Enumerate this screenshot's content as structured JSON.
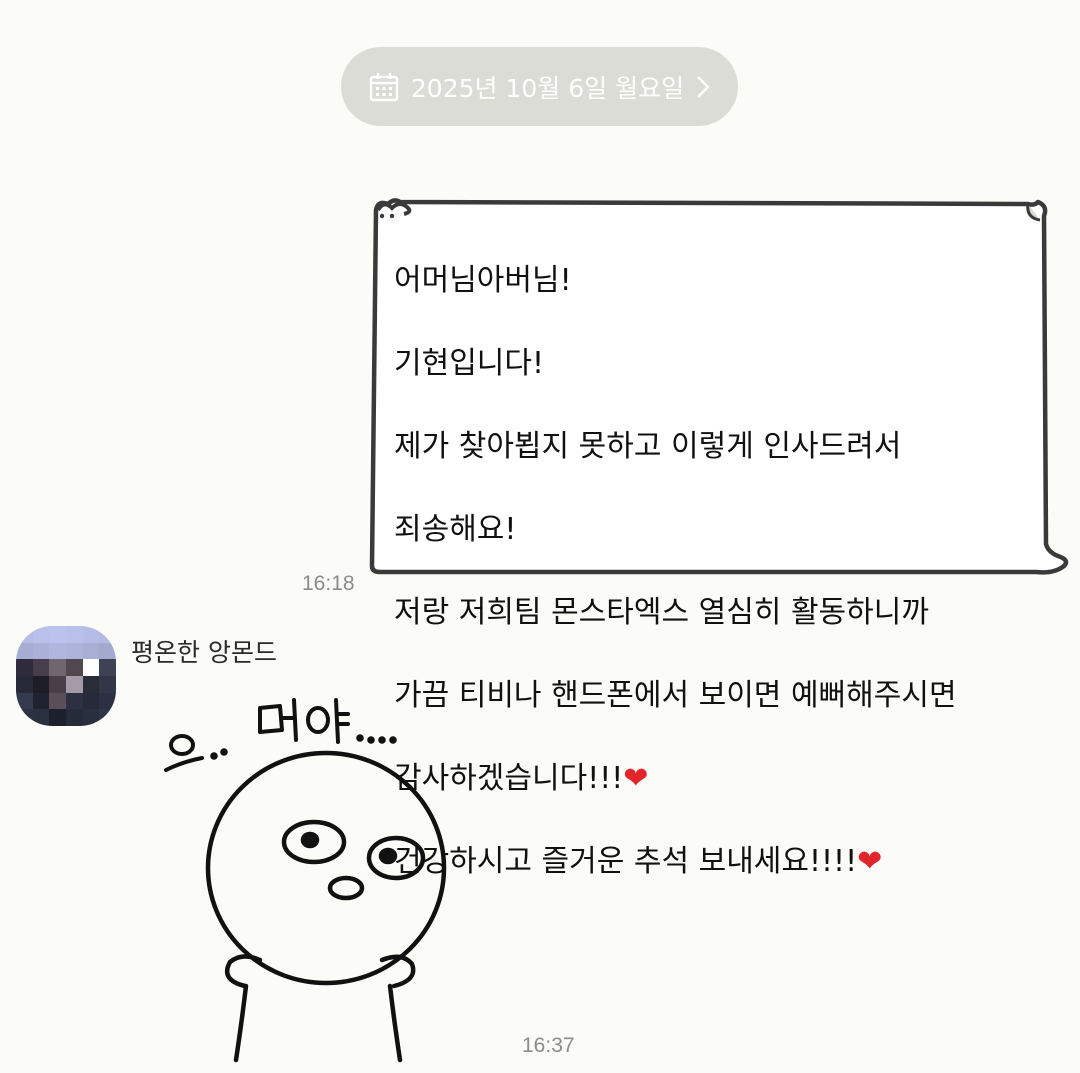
{
  "date_header": {
    "label": "2025년 10월 6일 월요일",
    "icon": "calendar-icon",
    "chevron": "chevron-right-icon"
  },
  "outgoing_message": {
    "lines": [
      "어머님아버님!",
      "기현입니다!",
      "제가 찾아뵙지 못하고 이렇게 인사드려서",
      "죄송해요!",
      "저랑 저희팀 몬스타엑스 열심히 활동하니까",
      "가끔 티비나 핸드폰에서 보이면 예뻐해주시면",
      "감사하겠습니다!!!",
      "건강하시고 즐거운 추석 보내세요!!!!"
    ],
    "heart_emoji_1": "❤",
    "heart_emoji_2": "❤",
    "time": "16:18"
  },
  "incoming_message": {
    "sender_name": "평온한 앙몬드",
    "sticker_caption": "으.. 머야...",
    "time": "16:37"
  },
  "colors": {
    "background": "#fbfbf7",
    "date_pill": "#dcdcd6",
    "bubble_border": "#3a3a3a",
    "heart": "#e0262b",
    "time_text": "#8b8b8b"
  }
}
